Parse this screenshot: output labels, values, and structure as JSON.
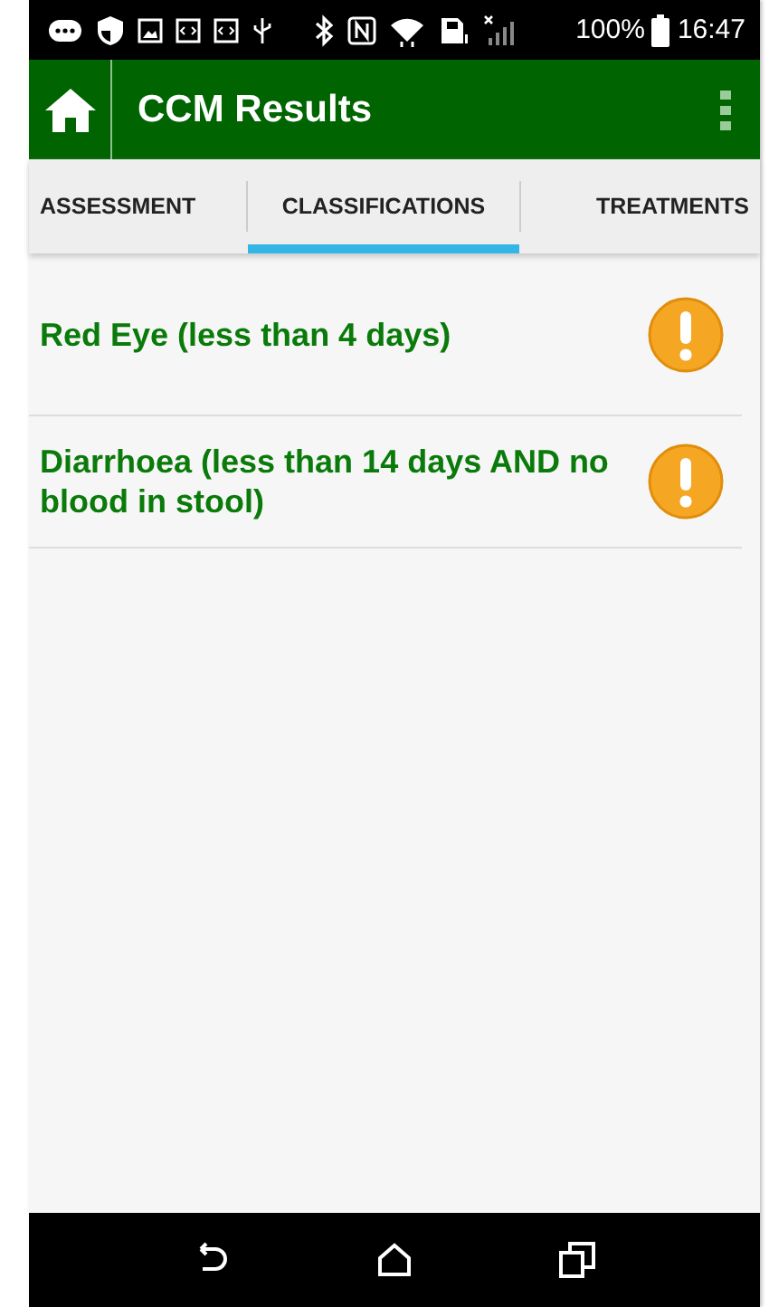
{
  "status_bar": {
    "battery": "100%",
    "time": "16:47"
  },
  "app_bar": {
    "title": "CCM Results"
  },
  "tabs": [
    {
      "label": "ASSESSMENT",
      "selected": false
    },
    {
      "label": "CLASSIFICATIONS",
      "selected": true
    },
    {
      "label": "TREATMENTS",
      "selected": false
    }
  ],
  "classifications": [
    {
      "text": "Red Eye (less than 4 days)"
    },
    {
      "text": "Diarrhoea (less than 14 days AND no blood in stool)"
    }
  ]
}
